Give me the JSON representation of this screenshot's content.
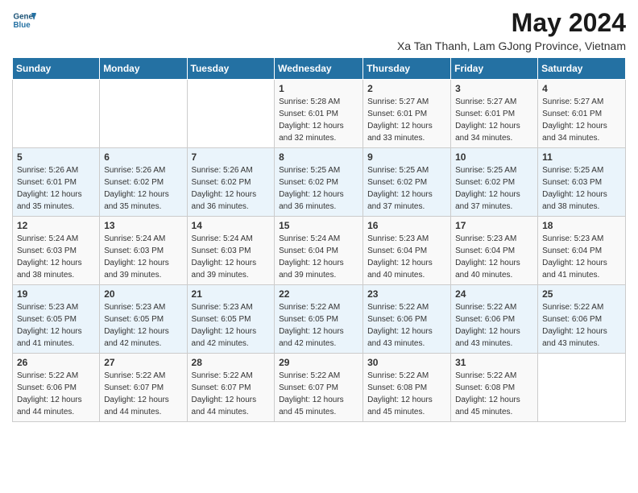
{
  "header": {
    "logo_line1": "General",
    "logo_line2": "Blue",
    "title": "May 2024",
    "subtitle": "Xa Tan Thanh, Lam GJong Province, Vietnam"
  },
  "calendar": {
    "days_of_week": [
      "Sunday",
      "Monday",
      "Tuesday",
      "Wednesday",
      "Thursday",
      "Friday",
      "Saturday"
    ],
    "weeks": [
      [
        {
          "day": "",
          "info": ""
        },
        {
          "day": "",
          "info": ""
        },
        {
          "day": "",
          "info": ""
        },
        {
          "day": "1",
          "info": "Sunrise: 5:28 AM\nSunset: 6:01 PM\nDaylight: 12 hours\nand 32 minutes."
        },
        {
          "day": "2",
          "info": "Sunrise: 5:27 AM\nSunset: 6:01 PM\nDaylight: 12 hours\nand 33 minutes."
        },
        {
          "day": "3",
          "info": "Sunrise: 5:27 AM\nSunset: 6:01 PM\nDaylight: 12 hours\nand 34 minutes."
        },
        {
          "day": "4",
          "info": "Sunrise: 5:27 AM\nSunset: 6:01 PM\nDaylight: 12 hours\nand 34 minutes."
        }
      ],
      [
        {
          "day": "5",
          "info": "Sunrise: 5:26 AM\nSunset: 6:01 PM\nDaylight: 12 hours\nand 35 minutes."
        },
        {
          "day": "6",
          "info": "Sunrise: 5:26 AM\nSunset: 6:02 PM\nDaylight: 12 hours\nand 35 minutes."
        },
        {
          "day": "7",
          "info": "Sunrise: 5:26 AM\nSunset: 6:02 PM\nDaylight: 12 hours\nand 36 minutes."
        },
        {
          "day": "8",
          "info": "Sunrise: 5:25 AM\nSunset: 6:02 PM\nDaylight: 12 hours\nand 36 minutes."
        },
        {
          "day": "9",
          "info": "Sunrise: 5:25 AM\nSunset: 6:02 PM\nDaylight: 12 hours\nand 37 minutes."
        },
        {
          "day": "10",
          "info": "Sunrise: 5:25 AM\nSunset: 6:02 PM\nDaylight: 12 hours\nand 37 minutes."
        },
        {
          "day": "11",
          "info": "Sunrise: 5:25 AM\nSunset: 6:03 PM\nDaylight: 12 hours\nand 38 minutes."
        }
      ],
      [
        {
          "day": "12",
          "info": "Sunrise: 5:24 AM\nSunset: 6:03 PM\nDaylight: 12 hours\nand 38 minutes."
        },
        {
          "day": "13",
          "info": "Sunrise: 5:24 AM\nSunset: 6:03 PM\nDaylight: 12 hours\nand 39 minutes."
        },
        {
          "day": "14",
          "info": "Sunrise: 5:24 AM\nSunset: 6:03 PM\nDaylight: 12 hours\nand 39 minutes."
        },
        {
          "day": "15",
          "info": "Sunrise: 5:24 AM\nSunset: 6:04 PM\nDaylight: 12 hours\nand 39 minutes."
        },
        {
          "day": "16",
          "info": "Sunrise: 5:23 AM\nSunset: 6:04 PM\nDaylight: 12 hours\nand 40 minutes."
        },
        {
          "day": "17",
          "info": "Sunrise: 5:23 AM\nSunset: 6:04 PM\nDaylight: 12 hours\nand 40 minutes."
        },
        {
          "day": "18",
          "info": "Sunrise: 5:23 AM\nSunset: 6:04 PM\nDaylight: 12 hours\nand 41 minutes."
        }
      ],
      [
        {
          "day": "19",
          "info": "Sunrise: 5:23 AM\nSunset: 6:05 PM\nDaylight: 12 hours\nand 41 minutes."
        },
        {
          "day": "20",
          "info": "Sunrise: 5:23 AM\nSunset: 6:05 PM\nDaylight: 12 hours\nand 42 minutes."
        },
        {
          "day": "21",
          "info": "Sunrise: 5:23 AM\nSunset: 6:05 PM\nDaylight: 12 hours\nand 42 minutes."
        },
        {
          "day": "22",
          "info": "Sunrise: 5:22 AM\nSunset: 6:05 PM\nDaylight: 12 hours\nand 42 minutes."
        },
        {
          "day": "23",
          "info": "Sunrise: 5:22 AM\nSunset: 6:06 PM\nDaylight: 12 hours\nand 43 minutes."
        },
        {
          "day": "24",
          "info": "Sunrise: 5:22 AM\nSunset: 6:06 PM\nDaylight: 12 hours\nand 43 minutes."
        },
        {
          "day": "25",
          "info": "Sunrise: 5:22 AM\nSunset: 6:06 PM\nDaylight: 12 hours\nand 43 minutes."
        }
      ],
      [
        {
          "day": "26",
          "info": "Sunrise: 5:22 AM\nSunset: 6:06 PM\nDaylight: 12 hours\nand 44 minutes."
        },
        {
          "day": "27",
          "info": "Sunrise: 5:22 AM\nSunset: 6:07 PM\nDaylight: 12 hours\nand 44 minutes."
        },
        {
          "day": "28",
          "info": "Sunrise: 5:22 AM\nSunset: 6:07 PM\nDaylight: 12 hours\nand 44 minutes."
        },
        {
          "day": "29",
          "info": "Sunrise: 5:22 AM\nSunset: 6:07 PM\nDaylight: 12 hours\nand 45 minutes."
        },
        {
          "day": "30",
          "info": "Sunrise: 5:22 AM\nSunset: 6:08 PM\nDaylight: 12 hours\nand 45 minutes."
        },
        {
          "day": "31",
          "info": "Sunrise: 5:22 AM\nSunset: 6:08 PM\nDaylight: 12 hours\nand 45 minutes."
        },
        {
          "day": "",
          "info": ""
        }
      ]
    ]
  }
}
